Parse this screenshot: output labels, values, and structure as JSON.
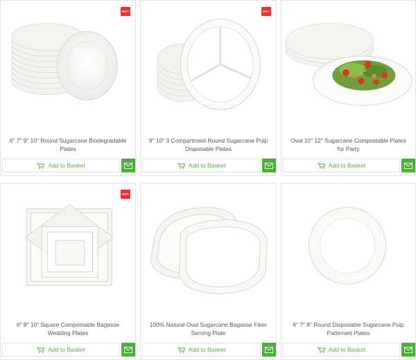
{
  "products": [
    {
      "title": "6\" 7\" 9\" 10\" Round Sugarcane Biodegradable Plates",
      "badge": "HOT",
      "button_label": "Add to Basket"
    },
    {
      "title": "9\" 10\" 3 Compartment Round Sugarcane Pulp Disposable Plates",
      "badge": "HOT",
      "button_label": "Add to Basket"
    },
    {
      "title": "Oval 10\" 12\" Sugarcane Compostable Plates for Party",
      "badge": "",
      "button_label": "Add to Basket"
    },
    {
      "title": "6\" 8\" 10\" Square Compostable Bagasse Wedding Plates",
      "badge": "HOT",
      "button_label": "Add to Basket"
    },
    {
      "title": "100% Natural Oval Sugarcane Bagasse Fiber Serving Plate",
      "badge": "",
      "button_label": "Add to Basket"
    },
    {
      "title": "6\" 7\" 8\" Round Disposable Sugarcane Pulp Patterned Plates",
      "badge": "",
      "button_label": "Add to Basket"
    }
  ],
  "icons": {
    "basket": "basket-icon",
    "email": "email-icon"
  },
  "colors": {
    "hot_badge": "#e5322d",
    "accent_green": "#4caf3a",
    "button_text": "#5daa3c"
  }
}
